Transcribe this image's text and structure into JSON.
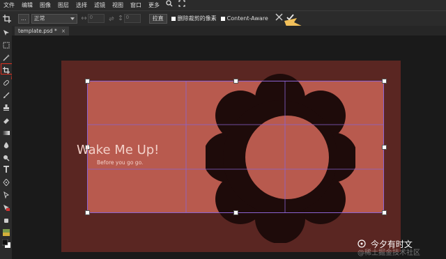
{
  "menu": {
    "items": [
      "文件",
      "编辑",
      "图像",
      "图层",
      "选择",
      "滤镜",
      "视图",
      "窗口",
      "更多"
    ]
  },
  "options": {
    "ratio_value": "...",
    "mode_value": "正常",
    "width_placeholder": "0",
    "height_placeholder": "0",
    "straighten_label": "拉直",
    "delete_cropped_label": "删除裁剪的像素",
    "content_aware_label": "Content-Aware"
  },
  "tab": {
    "title": "template.psd *",
    "close": "×"
  },
  "document": {
    "headline": "Wake Me Up!",
    "subline": "Before you go go."
  },
  "watermark": {
    "text": "今夕有时文",
    "faint": "@稀土掘金技术社区"
  },
  "colors": {
    "canvas_bg": "#5a2622",
    "crop_area": "#b85a4e",
    "flower": "#1e0b0a",
    "flower_center": "#b85a4e",
    "grid_line": "#8a63d2",
    "annotation_arrow": "#f2c05a",
    "highlight": "#e03020"
  },
  "icons": {
    "search": "search-icon",
    "fullscreen": "fullscreen-icon",
    "cancel": "close-icon",
    "commit": "checkmark-icon"
  }
}
